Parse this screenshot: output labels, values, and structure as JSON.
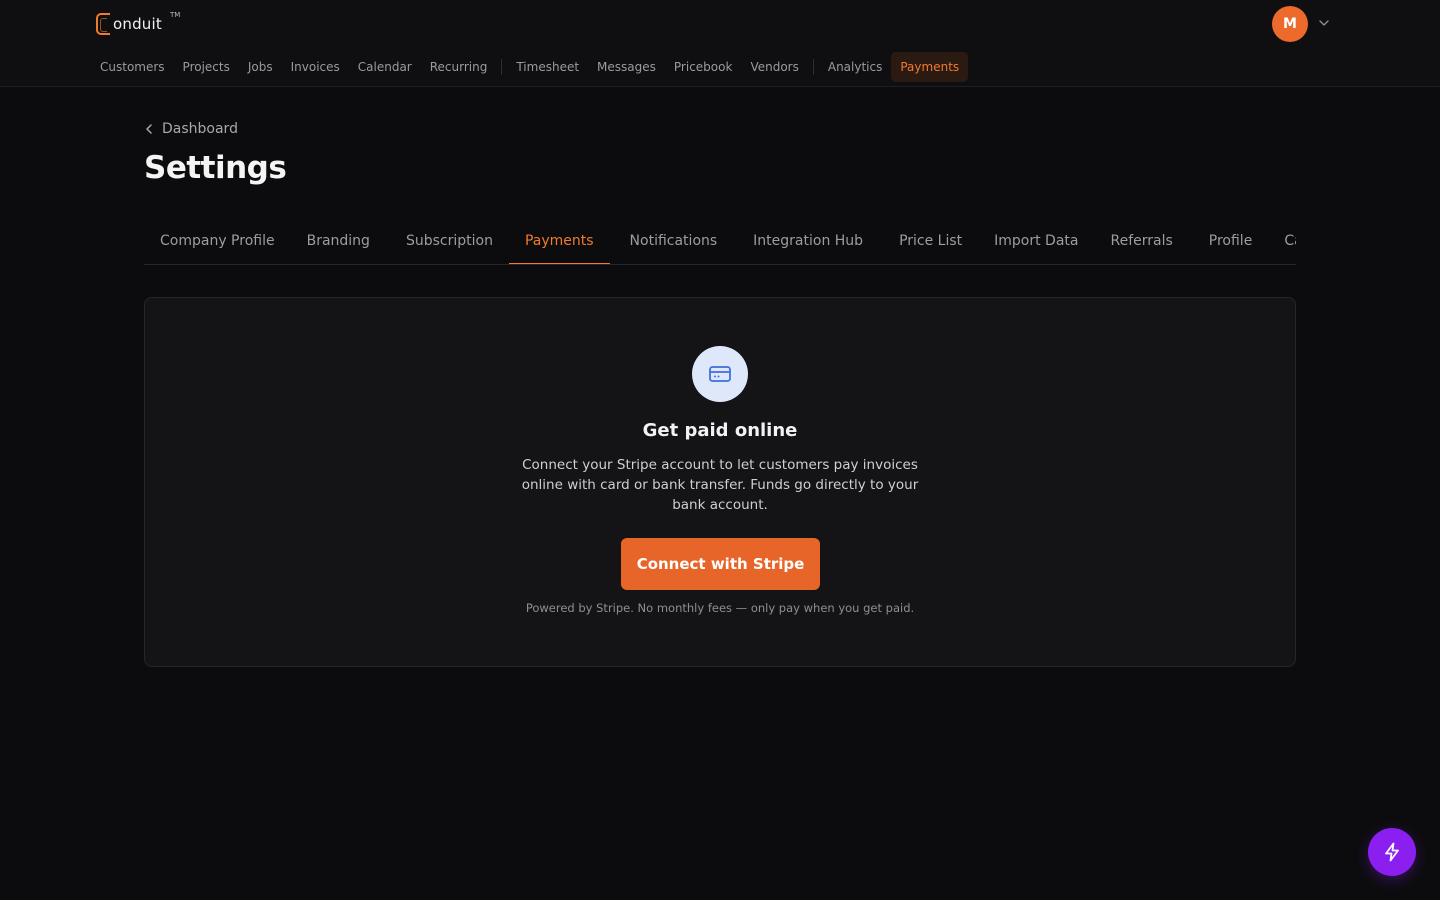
{
  "header": {
    "logo_text": "onduit",
    "logo_tm": "TM",
    "nav": [
      {
        "label": "Customers"
      },
      {
        "label": "Projects"
      },
      {
        "label": "Jobs"
      },
      {
        "label": "Invoices"
      },
      {
        "label": "Calendar"
      },
      {
        "label": "Recurring"
      },
      {
        "label": "Timesheet"
      },
      {
        "label": "Messages"
      },
      {
        "label": "Pricebook"
      },
      {
        "label": "Vendors"
      },
      {
        "label": "Analytics"
      },
      {
        "label": "Payments",
        "active": true
      }
    ],
    "avatar_initial": "M"
  },
  "breadcrumb": {
    "label": "Dashboard"
  },
  "page_title": "Settings",
  "tabs": [
    {
      "label": "Company Profile"
    },
    {
      "label": "Branding"
    },
    {
      "label": "Subscription"
    },
    {
      "label": "Payments",
      "active": true
    },
    {
      "label": "Notifications"
    },
    {
      "label": "Integration Hub"
    },
    {
      "label": "Price List"
    },
    {
      "label": "Import Data"
    },
    {
      "label": "Referrals"
    },
    {
      "label": "Profile"
    },
    {
      "label": "Cale"
    }
  ],
  "card": {
    "icon": "credit-card-icon",
    "title": "Get paid online",
    "description": "Connect your Stripe account to let customers pay invoices online with card or bank transfer. Funds go directly to your bank account.",
    "button_label": "Connect with Stripe",
    "footnote": "Powered by Stripe. No monthly fees — only pay when you get paid."
  },
  "colors": {
    "accent": "#f07a2e",
    "button": "#e8652a",
    "fab": "#8a1ff0",
    "icon_bg": "#dfe8fb",
    "icon_fg": "#3b6fe0"
  },
  "fab_icon": "lightning-icon"
}
